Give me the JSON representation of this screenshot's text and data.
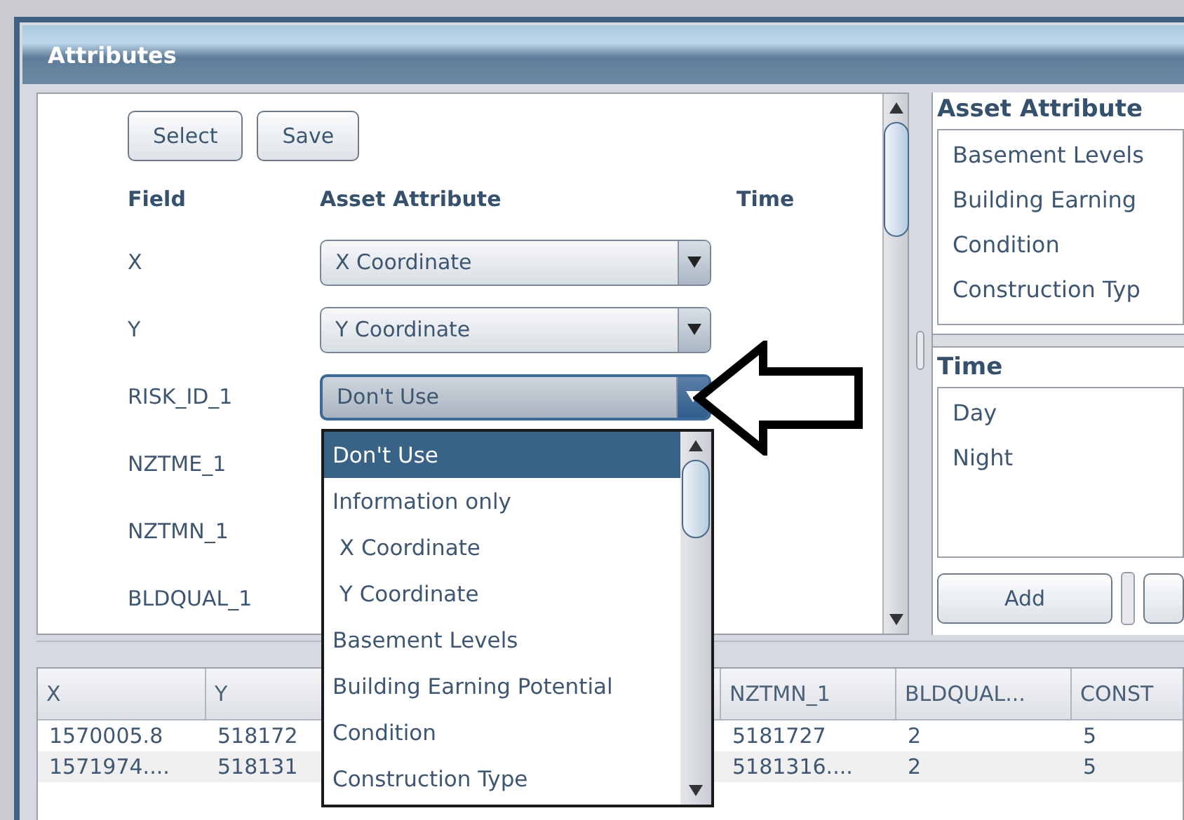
{
  "window": {
    "title": "Attributes"
  },
  "mapping": {
    "buttons": [
      "Select",
      "Save"
    ],
    "headers": {
      "field": "Field",
      "attribute": "Asset Attribute",
      "time": "Time"
    },
    "rows": [
      {
        "field": "X",
        "attribute": "X Coordinate",
        "open": false
      },
      {
        "field": "Y",
        "attribute": "Y Coordinate",
        "open": false
      },
      {
        "field": "RISK_ID_1",
        "attribute": "Don't Use",
        "open": true
      },
      {
        "field": "NZTME_1"
      },
      {
        "field": "NZTMN_1"
      },
      {
        "field": "BLDQUAL_1"
      }
    ]
  },
  "dropdown": {
    "options": [
      {
        "label": "Don't Use",
        "selected": true
      },
      {
        "label": "Information only",
        "selected": false
      },
      {
        "label": " X Coordinate",
        "selected": false
      },
      {
        "label": " Y Coordinate",
        "selected": false
      },
      {
        "label": "Basement Levels",
        "selected": false
      },
      {
        "label": "Building Earning Potential",
        "selected": false
      },
      {
        "label": "Condition",
        "selected": false
      },
      {
        "label": "Construction Type",
        "selected": false
      }
    ]
  },
  "asset_attributes": {
    "title": "Asset Attribute",
    "items": [
      "Basement Levels",
      "Building Earning",
      "Condition",
      "Construction Typ"
    ]
  },
  "time": {
    "title": "Time",
    "items": [
      "Day",
      "Night"
    ],
    "buttons": [
      "Add"
    ]
  },
  "table": {
    "columns": [
      "X",
      "Y",
      "NZTMN_1",
      "BLDQUAL...",
      "CONST"
    ],
    "rows": [
      [
        "1570005.8",
        "518172",
        "5181727",
        "2",
        "5"
      ],
      [
        "1571974....",
        "518131",
        "5181316....",
        "2",
        "5"
      ]
    ]
  }
}
